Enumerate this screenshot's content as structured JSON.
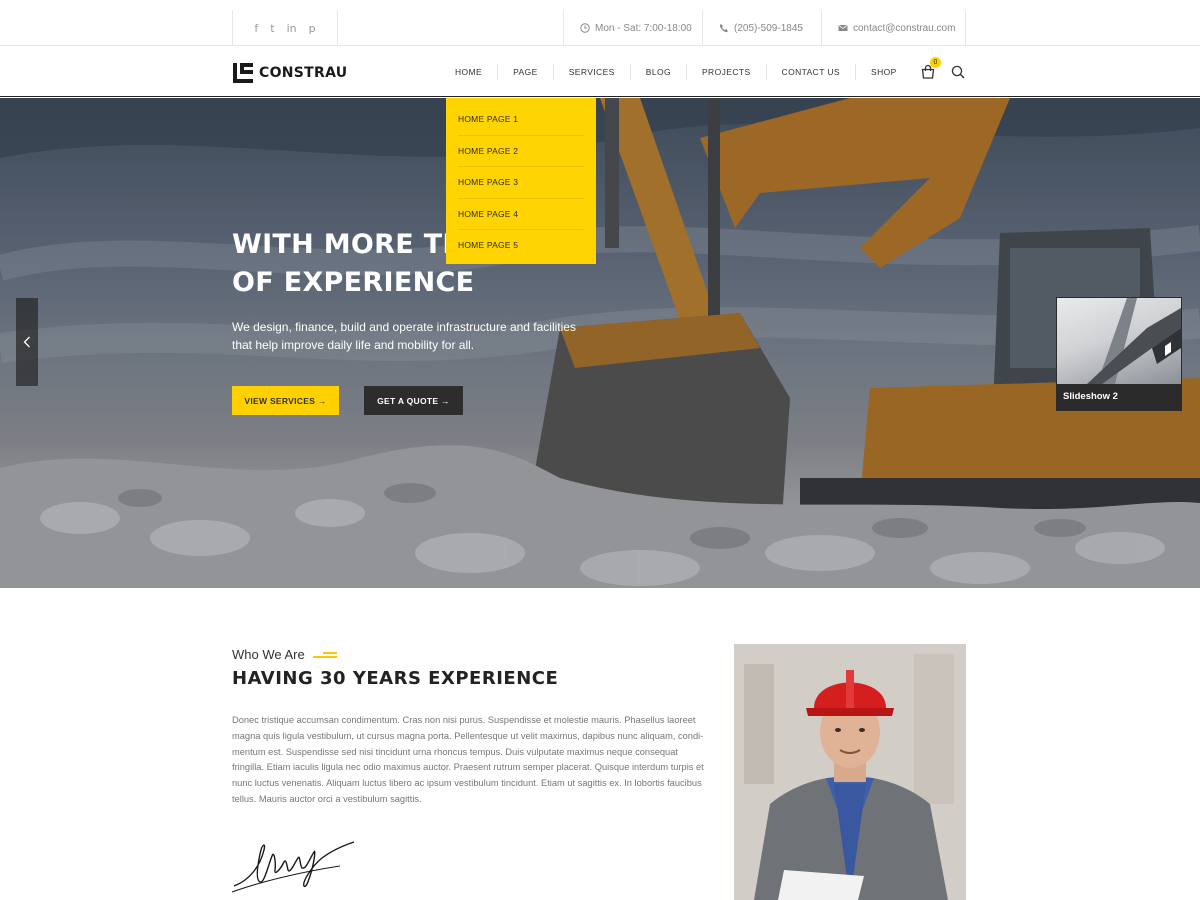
{
  "topbar": {
    "social": [
      {
        "name": "facebook-icon",
        "glyph": "f"
      },
      {
        "name": "twitter-icon",
        "glyph": "t"
      },
      {
        "name": "linkedin-icon",
        "glyph": "in"
      },
      {
        "name": "pinterest-icon",
        "glyph": "p"
      }
    ],
    "hours": "Mon - Sat: 7:00-18:00",
    "phone": "(205)-509-1845",
    "email": "contact@constrau.com"
  },
  "header": {
    "logo_text": "CONSTRAU",
    "nav": [
      "HOME",
      "PAGE",
      "SERVICES",
      "BLOG",
      "PROJECTS",
      "CONTACT US",
      "SHOP"
    ],
    "cart_count": "0"
  },
  "dropdown": {
    "items": [
      "HOME PAGE 1",
      "HOME PAGE 2",
      "HOME PAGE 3",
      "HOME PAGE 4",
      "HOME PAGE 5"
    ]
  },
  "hero": {
    "title_line1": "WITH MORE THAN",
    "title_line2": "OF EXPERIENCE",
    "description": "We design, finance, build and operate infrastructure and facilities that help improve daily life and mobility for all.",
    "btn_primary": "VIEW SERVICES →",
    "btn_secondary": "GET A QUOTE →",
    "thumb_label": "Slideshow 2"
  },
  "about": {
    "eyebrow": "Who We Are",
    "title": "HAVING 30 YEARS EXPERIENCE",
    "text": "Donec tristique accumsan condimentum. Cras non nisi purus. Suspendisse et molestie mauris. Phasellus laoreet magna quis ligula vestibulum, ut cursus magna porta. Pellentesque ut velit maximus, dapibus nunc aliquam, condi-mentum est. Suspendisse sed nisi tincidunt urna rhoncus tempus. Duis vulputate maximus neque consequat fringilla. Etiam iaculis ligula nec odio maximus auctor. Praesent rutrum semper placerat. Quisque interdum turpis et nunc luctus venenatis. Aliquam luctus libero ac ipsum vestibulum tincidunt. Etiam ut sagittis ex. In lobortis faucibus tellus. Mauris auctor orci a vestibulum sagittis."
  },
  "colors": {
    "accent": "#ffd100",
    "dark": "#2d2d2d"
  }
}
